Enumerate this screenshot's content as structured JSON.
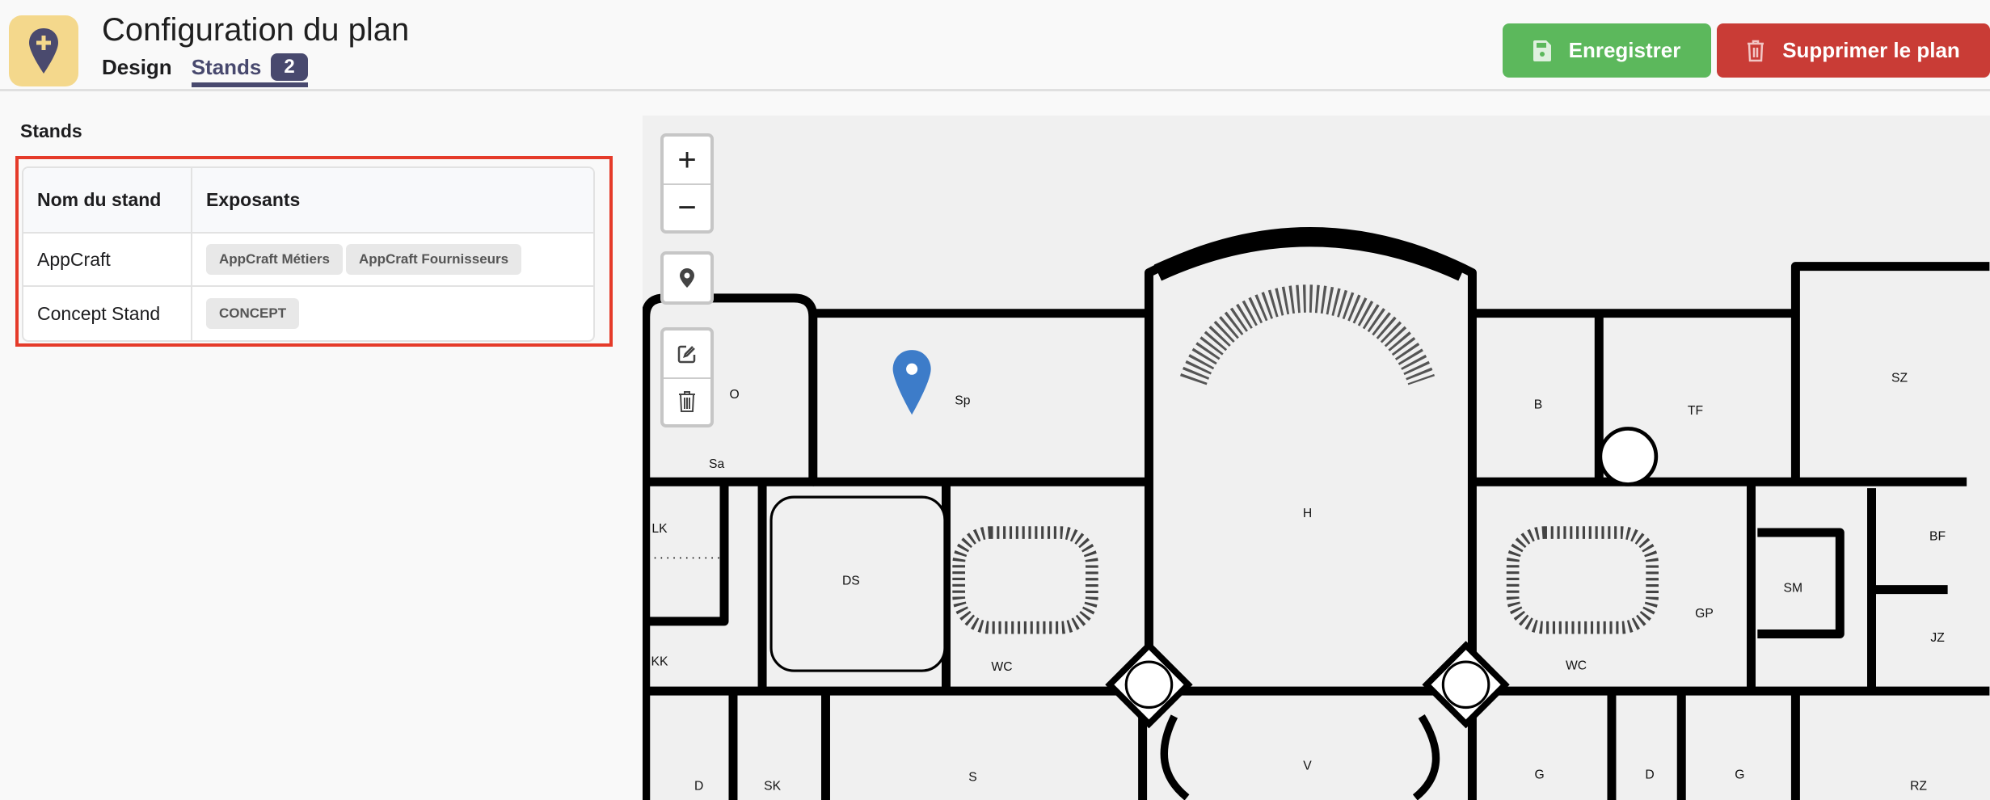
{
  "header": {
    "title": "Configuration du plan",
    "tabs": [
      {
        "label": "Design"
      },
      {
        "label": "Stands",
        "count": "2",
        "active": true
      }
    ],
    "save_label": "Enregistrer",
    "delete_label": "Supprimer le plan"
  },
  "stands": {
    "title": "Stands",
    "columns": [
      "Nom du stand",
      "Exposants"
    ],
    "rows": [
      {
        "name": "AppCraft",
        "exhibitors": [
          "AppCraft Métiers",
          "AppCraft Fournisseurs"
        ]
      },
      {
        "name": "Concept Stand",
        "exhibitors": [
          "CONCEPT"
        ]
      }
    ]
  },
  "map": {
    "zoom_in": "+",
    "zoom_out": "−",
    "rooms": [
      "O",
      "Sp",
      "Sa",
      "LK",
      "KK",
      "DS",
      "WC",
      "H",
      "B",
      "TF",
      "SZ",
      "BF",
      "SM",
      "JZ",
      "GP",
      "WC",
      "D",
      "SK",
      "S",
      "V",
      "G",
      "D",
      "G",
      "RZ"
    ],
    "marker_color": "#3d7cc9"
  },
  "colors": {
    "accent": "#48496e",
    "save": "#5cb85c",
    "delete": "#c93c36",
    "highlight": "#e53b2a",
    "icon_bg": "#f4d88c"
  }
}
